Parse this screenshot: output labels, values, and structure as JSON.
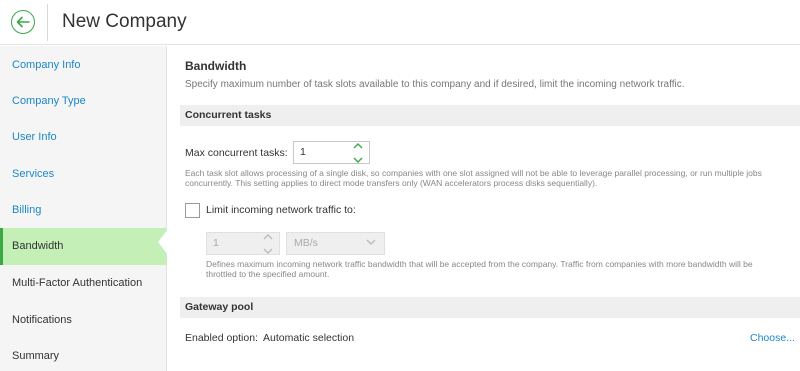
{
  "header": {
    "title": "New Company"
  },
  "sidebar": {
    "items": [
      {
        "label": "Company Info"
      },
      {
        "label": "Company Type"
      },
      {
        "label": "User Info"
      },
      {
        "label": "Services"
      },
      {
        "label": "Billing"
      },
      {
        "label": "Bandwidth"
      },
      {
        "label": "Multi-Factor Authentication"
      },
      {
        "label": "Notifications"
      },
      {
        "label": "Summary"
      }
    ],
    "active": "Bandwidth"
  },
  "main": {
    "title": "Bandwidth",
    "description": "Specify maximum number of task slots available to this company and if desired, limit the incoming network traffic.",
    "concurrent": {
      "header": "Concurrent tasks",
      "max_label": "Max concurrent tasks:",
      "max_value": "1",
      "hint": "Each task slot allows processing of a single disk, so companies with one slot assigned will not be able to leverage parallel processing, or run multiple jobs concurrently. This setting applies to direct mode transfers only (WAN accelerators process disks sequentially).",
      "limit_label": "Limit incoming network traffic to:",
      "limit_checked": false,
      "limit_value": "1",
      "limit_unit": "MB/s",
      "limit_hint": "Defines maximum incoming network traffic bandwidth that will be accepted from the company. Traffic from companies with more bandwidth will be throttled to the specified amount."
    },
    "gateway": {
      "header": "Gateway pool",
      "enabled_label": "Enabled option:",
      "enabled_value": "Automatic selection",
      "choose_label": "Choose..."
    }
  },
  "colors": {
    "accent": "#3aa845",
    "active_bg": "#c4f0b8",
    "link": "#1b87c9"
  }
}
